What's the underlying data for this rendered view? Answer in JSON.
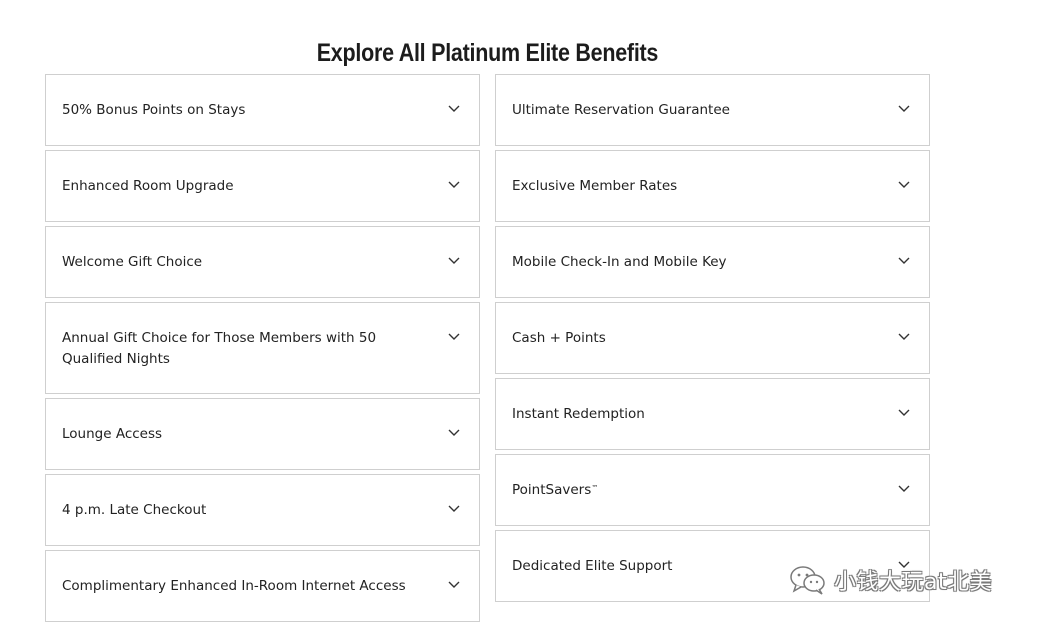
{
  "page": {
    "title": "Explore All Platinum Elite Benefits"
  },
  "benefits": {
    "left": [
      {
        "label": "50% Bonus Points on Stays"
      },
      {
        "label": "Enhanced Room Upgrade"
      },
      {
        "label": "Welcome Gift Choice"
      },
      {
        "label": "Annual Gift Choice for Those Members with 50 Qualified Nights"
      },
      {
        "label": "Lounge Access"
      },
      {
        "label": "4 p.m. Late Checkout"
      },
      {
        "label": "Complimentary Enhanced In-Room Internet Access"
      }
    ],
    "right": [
      {
        "label": "Ultimate Reservation Guarantee"
      },
      {
        "label": "Exclusive Member Rates"
      },
      {
        "label": "Mobile Check-In and Mobile Key"
      },
      {
        "label": "Cash + Points"
      },
      {
        "label": "Instant Redemption"
      },
      {
        "label": "PointSavers",
        "trademark": "™"
      },
      {
        "label": "Dedicated Elite Support"
      }
    ]
  },
  "icons": {
    "expand": "chevron-down-icon",
    "watermark": "wechat-icon"
  },
  "watermark": {
    "text": "小钱大玩at北美"
  },
  "colors": {
    "border": "#cfcfcf",
    "text": "#222222",
    "title": "#1c1c1c"
  }
}
